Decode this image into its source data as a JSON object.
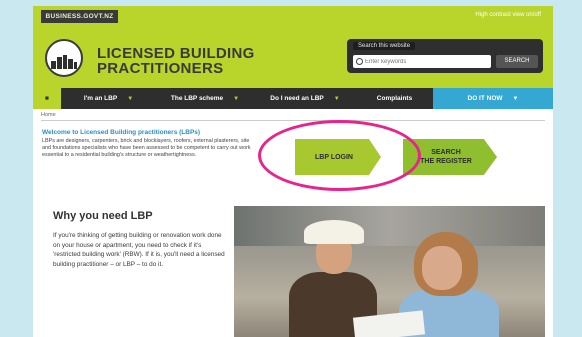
{
  "header": {
    "gov_link": "BUSINESS.GOVT.NZ",
    "high_contrast": "High contrast view on/off",
    "logo_line1": "LICENSED BUILDING",
    "logo_line2": "PRACTITIONERS",
    "search_label": "Search this website",
    "search_placeholder": "Enter keywords",
    "search_button": "SEARCH"
  },
  "nav": {
    "items": [
      {
        "label": "I'm an LBP"
      },
      {
        "label": "The LBP scheme"
      },
      {
        "label": "Do I need an LBP"
      },
      {
        "label": "Complaints"
      },
      {
        "label": "DO IT NOW"
      }
    ],
    "chevron": "▼"
  },
  "breadcrumb": "Home",
  "welcome": {
    "title": "Welcome to Licensed Building practitioners (LBPs)",
    "body": "LBPs are designers, carpenters, brick and blocklayers, roofers, external plasterers, site and foundations specialists who have been assessed to be competent to carry out work essential to a residential building's structure or weathertightness."
  },
  "buttons": {
    "login": "LBP LOGIN",
    "register_line1": "SEARCH",
    "register_line2": "THE REGISTER"
  },
  "why": {
    "title": "Why you need LBP",
    "body": "If you're thinking of getting building or renovation work done on your house or apartment, you need to check if it's 'restricted building work' (RBW). If it is, you'll need a licensed building practitioner – or LBP – to do it."
  },
  "colors": {
    "brand_green": "#b9d42a",
    "nav_dark": "#2e2e2e",
    "do_it_now_blue": "#34a7d3",
    "highlight_magenta": "#e8248c"
  }
}
